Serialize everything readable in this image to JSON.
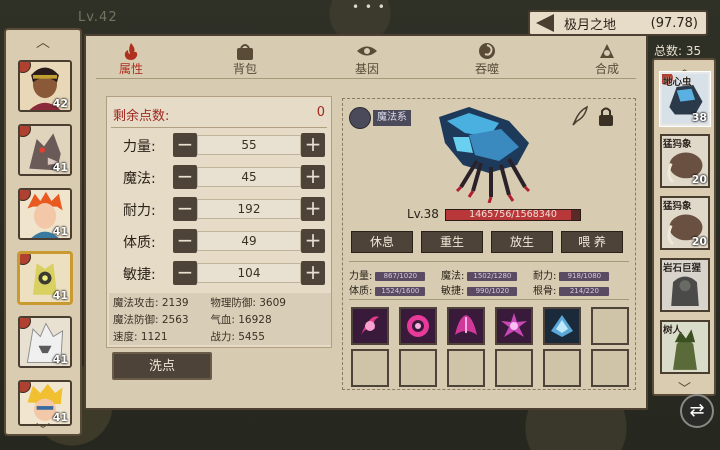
{
  "top": {
    "level": "Lv.42",
    "area_name": "极月之地",
    "area_coords": "(97.78)"
  },
  "tabs": [
    {
      "label": "属性",
      "icon": "flame-icon",
      "active": true
    },
    {
      "label": "背包",
      "icon": "bag-icon",
      "active": false
    },
    {
      "label": "基因",
      "icon": "eye-icon",
      "active": false
    },
    {
      "label": "吞噬",
      "icon": "swirl-icon",
      "active": false
    },
    {
      "label": "合成",
      "icon": "fusion-icon",
      "active": false
    }
  ],
  "heroes": [
    {
      "level": "42"
    },
    {
      "level": "41"
    },
    {
      "level": "41"
    },
    {
      "level": "41"
    },
    {
      "level": "41"
    },
    {
      "level": "41"
    }
  ],
  "stats": {
    "remaining_label": "剩余点数:",
    "remaining_value": "0",
    "rows": [
      {
        "label": "力量:",
        "value": "55"
      },
      {
        "label": "魔法:",
        "value": "45"
      },
      {
        "label": "耐力:",
        "value": "192"
      },
      {
        "label": "体质:",
        "value": "49"
      },
      {
        "label": "敏捷:",
        "value": "104"
      }
    ],
    "derived": [
      [
        "魔法攻击: 2139",
        "物理防御: 3609"
      ],
      [
        "魔法防御: 2563",
        "气血: 16928"
      ],
      [
        "速度: 1121",
        "战力: 5455"
      ]
    ],
    "reset_label": "洗点"
  },
  "character": {
    "school": "魔法系",
    "level": "Lv.38",
    "hp_text": "1465756/1568340",
    "hp_fraction": 0.935,
    "actions": [
      "休息",
      "重生",
      "放生",
      "喂 养"
    ],
    "attrs": [
      {
        "label": "力量:",
        "value": "867/1020"
      },
      {
        "label": "魔法:",
        "value": "1502/1280"
      },
      {
        "label": "耐力:",
        "value": "918/1080"
      },
      {
        "label": "体质:",
        "value": "1524/1600"
      },
      {
        "label": "敏捷:",
        "value": "990/1020"
      },
      {
        "label": "根骨:",
        "value": "214/220"
      }
    ],
    "skills": [
      {
        "icon": "claw-skill-icon",
        "color": "#e23a8c"
      },
      {
        "icon": "spiral-skill-icon",
        "color": "#e83a9a"
      },
      {
        "icon": "wing-skill-icon",
        "color": "#d0389a"
      },
      {
        "icon": "burst-skill-icon",
        "color": "#c848b8"
      },
      {
        "icon": "crystal-skill-icon",
        "color": "#5aa8d8"
      }
    ]
  },
  "pets": {
    "total_label": "总数: 35",
    "items": [
      {
        "name": "地心虫",
        "level": "38",
        "selected": true
      },
      {
        "name": "猛犸象",
        "level": "20"
      },
      {
        "name": "猛犸象",
        "level": "20"
      },
      {
        "name": "岩石巨猩",
        "level": ""
      },
      {
        "name": "树人",
        "level": ""
      }
    ]
  }
}
